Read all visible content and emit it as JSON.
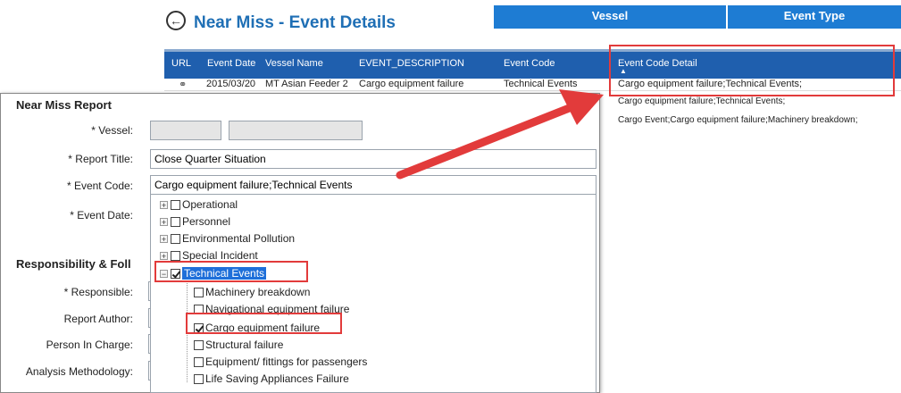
{
  "back_window": {
    "title": "Near Miss - Event Details",
    "back_icon": "back-arrow-icon",
    "top_tabs": [
      "Vessel",
      "Event Type"
    ],
    "grid": {
      "columns": [
        "URL",
        "Event Date",
        "Vessel Name",
        "EVENT_DESCRIPTION",
        "Event Code",
        "Event Code Detail"
      ],
      "rows": [
        {
          "url_icon": "link-icon",
          "event_date": "2015/03/20",
          "vessel_name": "MT Asian Feeder 2",
          "description": "Cargo equipment failure",
          "event_code": "Technical Events",
          "event_code_detail": "Cargo equipment failure;Technical Events;"
        }
      ],
      "extra_details": [
        "Cargo equipment failure;Technical Events;",
        "Cargo Event;Cargo equipment failure;Machinery breakdown;"
      ]
    }
  },
  "form": {
    "title": "Near Miss Report",
    "labels": {
      "vessel": "* Vessel:",
      "report_title": "* Report Title:",
      "event_code": "* Event Code:",
      "event_date": "* Event Date:",
      "responsible": "* Responsible:",
      "report_author": "Report Author:",
      "person_in_charge": "Person In Charge:",
      "analysis_methodology": "Analysis Methodology:"
    },
    "values": {
      "report_title": "Close Quarter Situation",
      "event_code": "Cargo equipment failure;Technical Events"
    },
    "section2": "Responsibility & Foll"
  },
  "tree": {
    "roots": [
      {
        "label": "Operational",
        "checked": false
      },
      {
        "label": "Personnel",
        "checked": false
      },
      {
        "label": "Environmental Pollution",
        "checked": false
      },
      {
        "label": "Special Incident",
        "checked": false
      },
      {
        "label": "Technical Events",
        "checked": true
      }
    ],
    "children": [
      {
        "label": "Machinery breakdown",
        "checked": false
      },
      {
        "label": "Navigational equipment failure",
        "checked": false
      },
      {
        "label": "Cargo equipment failure",
        "checked": true
      },
      {
        "label": "Structural failure",
        "checked": false
      },
      {
        "label": "Equipment/ fittings for passengers",
        "checked": false
      },
      {
        "label": "Life Saving Appliances Failure",
        "checked": false
      }
    ]
  },
  "colors": {
    "title_blue": "#1f6fb5",
    "header_blue": "#1f5fae",
    "highlight_red": "#e23b3b",
    "selection_blue": "#1e6fd9"
  }
}
